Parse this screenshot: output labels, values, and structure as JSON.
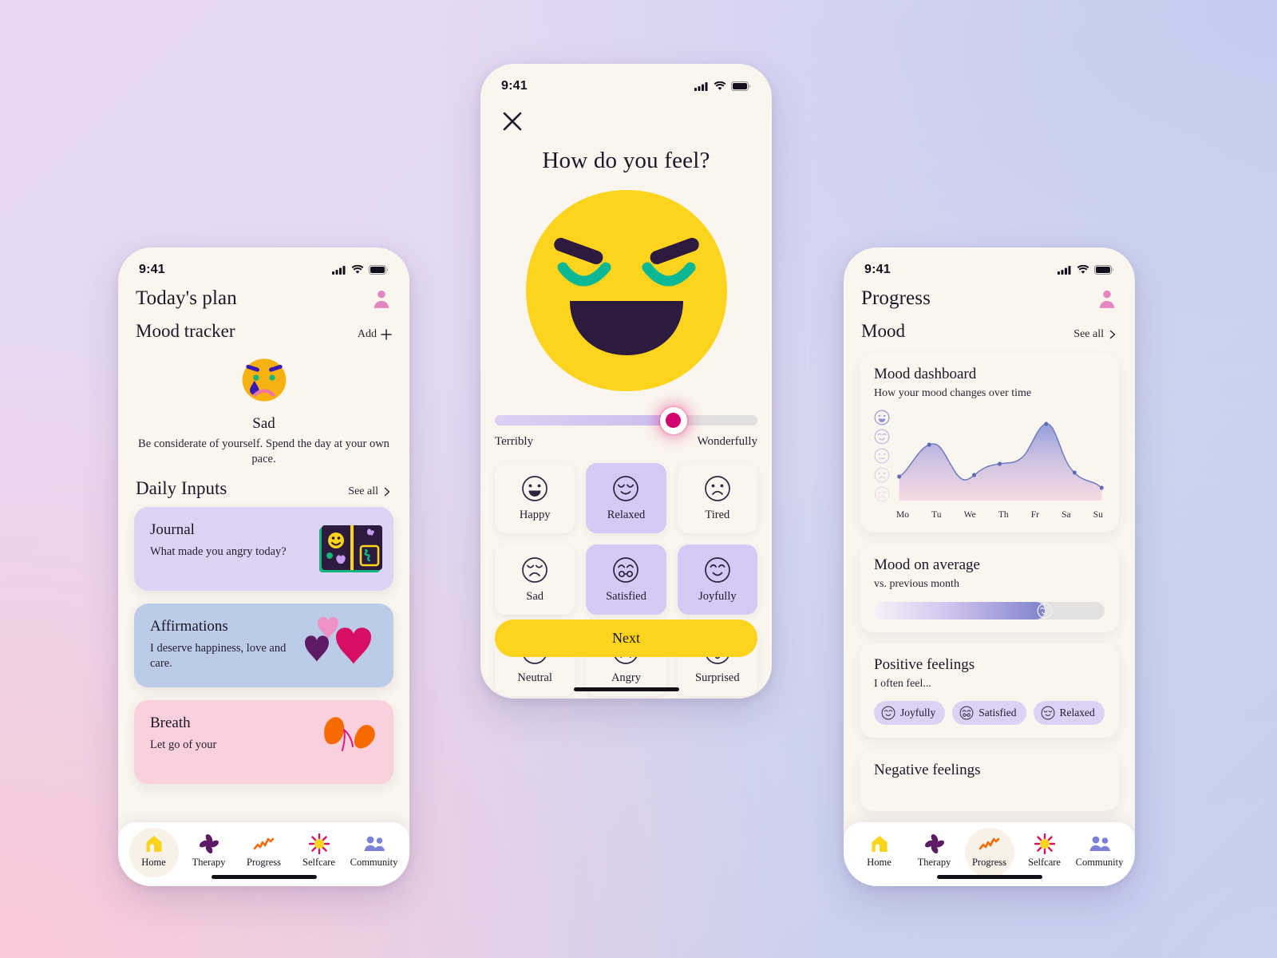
{
  "theme": {
    "bg_top_left": "#e9d8f1",
    "bg_top_right": "#c3ccf0",
    "bg_bottom_left": "#fbc8d8",
    "screen_bg": "#faf5ee",
    "accent_yellow": "#fcd31d",
    "accent_purple": "#d6c9f5",
    "accent_pink": "#d0006f",
    "ink": "#1b1626"
  },
  "status_bar": {
    "time": "9:41",
    "icons": [
      "cellular-icon",
      "wifi-icon",
      "battery-icon"
    ]
  },
  "left_screen": {
    "title": "Today's plan",
    "avatar_icon": "avatar-icon",
    "mood_tracker": {
      "title": "Mood tracker",
      "add_label": "Add",
      "add_icon": "plus-icon",
      "emoji": "crying-face-emoji",
      "mood_name": "Sad",
      "description": "Be considerate of yourself. Spend the day at your own pace."
    },
    "daily_inputs": {
      "title": "Daily Inputs",
      "see_all_label": "See all",
      "see_all_icon": "chevron-right-icon",
      "cards": [
        {
          "title": "Journal",
          "text": "What made you angry today?",
          "bg": "#ddd3f4",
          "art": "journal-art-icon"
        },
        {
          "title": "Affirmations",
          "text": "I deserve happiness, love and care.",
          "bg": "#bccbe8",
          "art": "hearts-art-icon"
        },
        {
          "title": "Breath",
          "text": "Let go of your",
          "bg": "#fbd0dd",
          "art": "butterfly-art-icon"
        }
      ]
    }
  },
  "center_screen": {
    "close_icon": "close-icon",
    "question": "How do you feel?",
    "hero_emoji": "relaxed-grinning-face-emoji",
    "slider": {
      "value_percent": 68,
      "min_label": "Terribly",
      "max_label": "Wonderfully"
    },
    "moods": [
      {
        "label": "Happy",
        "icon": "grinning-face-icon",
        "selected": false
      },
      {
        "label": "Relaxed",
        "icon": "relaxed-face-icon",
        "selected": true
      },
      {
        "label": "Tired",
        "icon": "frowning-face-icon",
        "selected": false
      },
      {
        "label": "Sad",
        "icon": "sad-closed-eyes-icon",
        "selected": false
      },
      {
        "label": "Satisfied",
        "icon": "satisfied-face-icon",
        "selected": true
      },
      {
        "label": "Joyfully",
        "icon": "smiling-face-icon",
        "selected": true
      },
      {
        "label": "Neutral",
        "icon": "neutral-face-icon",
        "selected": false
      },
      {
        "label": "Angry",
        "icon": "angry-face-icon",
        "selected": false
      },
      {
        "label": "Surprised",
        "icon": "surprised-face-icon",
        "selected": false
      }
    ],
    "next_label": "Next"
  },
  "right_screen": {
    "title": "Progress",
    "avatar_icon": "avatar-icon",
    "mood_section": {
      "title": "Mood",
      "see_all_label": "See all",
      "see_all_icon": "chevron-right-icon"
    },
    "dashboard": {
      "title": "Mood dashboard",
      "subtitle": "How your mood changes over time",
      "y_icons": [
        "grinning-face-icon",
        "smiling-face-icon",
        "neutral-face-icon",
        "frowning-face-icon",
        "very-sad-face-icon"
      ]
    },
    "average": {
      "title": "Mood on average",
      "subtitle": "vs. previous month",
      "fill_percent": 74,
      "knob_icon": "smiling-face-icon"
    },
    "positive": {
      "title": "Positive feelings",
      "subtitle": "I often feel...",
      "chips": [
        {
          "label": "Joyfully",
          "icon": "smiling-face-icon"
        },
        {
          "label": "Satisfied",
          "icon": "satisfied-face-icon"
        },
        {
          "label": "Relaxed",
          "icon": "relaxed-face-icon"
        }
      ]
    },
    "negative": {
      "title": "Negative feelings"
    }
  },
  "tab_bar": {
    "items": [
      {
        "label": "Home",
        "icon": "house-icon"
      },
      {
        "label": "Therapy",
        "icon": "leaf-icon"
      },
      {
        "label": "Progress",
        "icon": "zigzag-icon"
      },
      {
        "label": "Selfcare",
        "icon": "sun-icon"
      },
      {
        "label": "Community",
        "icon": "people-icon"
      }
    ],
    "left_active": "Home",
    "right_active": "Progress"
  },
  "chart_data": {
    "type": "area",
    "title": "Mood dashboard",
    "subtitle": "How your mood changes over time",
    "categories": [
      "Mo",
      "Tu",
      "We",
      "Th",
      "Fr",
      "Sa",
      "Su"
    ],
    "values": [
      2.0,
      3.6,
      2.1,
      3.05,
      4.45,
      1.85,
      1.2
    ],
    "ylabel": "Mood",
    "xlabel": "",
    "ylim": [
      0,
      5
    ],
    "y_tick_icons": [
      "grinning-face-icon",
      "smiling-face-icon",
      "neutral-face-icon",
      "frowning-face-icon",
      "very-sad-face-icon"
    ],
    "grid": false,
    "legend": "none",
    "line_color": "#6f7cc0",
    "fill_gradient": [
      "#97a5dd",
      "#f6d7e0"
    ]
  }
}
